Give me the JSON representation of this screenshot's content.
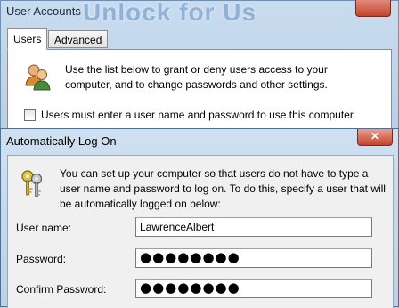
{
  "user_accounts": {
    "title": "User Accounts",
    "watermark": "Unlock for Us",
    "tabs": [
      {
        "label": "Users",
        "active": true
      },
      {
        "label": "Advanced",
        "active": false
      }
    ],
    "description": "Use the list below to grant or deny users access to your computer, and to change passwords and other settings.",
    "must_enter_label": "Users must enter a user name and password to use this computer.",
    "must_enter_checked": false
  },
  "auto_logon": {
    "title": "Automatically Log On",
    "close_glyph": "✕",
    "description": "You can set up your computer so that users do not have to type a user name and password to log on. To do this, specify a user that will be automatically logged on below:",
    "fields": {
      "user_name": {
        "label": "User name:",
        "value": "LawrenceAlbert"
      },
      "password": {
        "label": "Password:",
        "value": "●●●●●●●●"
      },
      "confirm_password": {
        "label": "Confirm Password:",
        "value": "●●●●●●●●"
      }
    }
  },
  "colors": {
    "accent": "#4f6f91",
    "close": "#c4432c"
  },
  "icons": [
    "users-icon",
    "keys-icon",
    "close-icon"
  ]
}
